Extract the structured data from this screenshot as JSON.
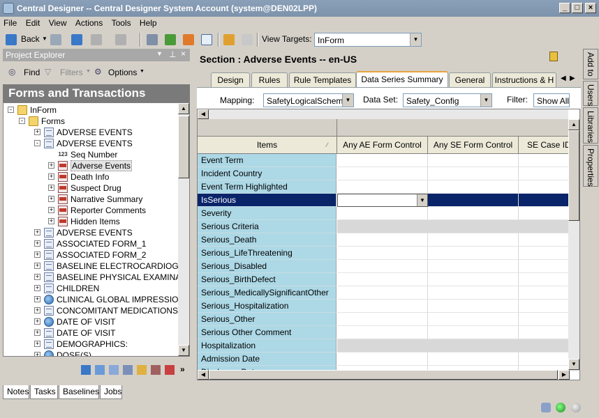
{
  "window": {
    "title": "Central Designer -- Central Designer System Account (system@DEN02LPP)"
  },
  "menu": [
    "File",
    "Edit",
    "View",
    "Actions",
    "Tools",
    "Help"
  ],
  "toolbar": {
    "back_label": "Back",
    "view_targets_label": "View Targets:",
    "view_targets_value": "InForm"
  },
  "project_explorer": {
    "title": "Project Explorer",
    "find_label": "Find",
    "filters_label": "Filters",
    "options_label": "Options",
    "heading": "Forms and Transactions"
  },
  "tree": [
    {
      "label": "InForm",
      "icon": "folder",
      "level": 0,
      "exp": "−"
    },
    {
      "label": "Forms",
      "icon": "folder",
      "level": 1,
      "exp": "−"
    },
    {
      "label": "ADVERSE EVENTS",
      "icon": "form",
      "level": 2,
      "exp": "+"
    },
    {
      "label": "ADVERSE EVENTS",
      "icon": "form",
      "level": 2,
      "exp": "−"
    },
    {
      "label": "Seq Number",
      "icon": "num",
      "level": 3,
      "exp": ""
    },
    {
      "label": "Adverse Events",
      "icon": "section",
      "level": 3,
      "exp": "+",
      "selected": true
    },
    {
      "label": "Death Info",
      "icon": "section",
      "level": 3,
      "exp": "+"
    },
    {
      "label": "Suspect Drug",
      "icon": "section",
      "level": 3,
      "exp": "+"
    },
    {
      "label": "Narrative Summary",
      "icon": "section",
      "level": 3,
      "exp": "+"
    },
    {
      "label": "Reporter Comments",
      "icon": "section",
      "level": 3,
      "exp": "+"
    },
    {
      "label": "Hidden Items",
      "icon": "section",
      "level": 3,
      "exp": "+"
    },
    {
      "label": "ADVERSE EVENTS",
      "icon": "form",
      "level": 2,
      "exp": "+"
    },
    {
      "label": "ASSOCIATED FORM_1",
      "icon": "form",
      "level": 2,
      "exp": "+"
    },
    {
      "label": "ASSOCIATED FORM_2",
      "icon": "form",
      "level": 2,
      "exp": "+"
    },
    {
      "label": "BASELINE ELECTROCARDIOG",
      "icon": "form",
      "level": 2,
      "exp": "+"
    },
    {
      "label": "BASELINE PHYSICAL EXAMINA",
      "icon": "form",
      "level": 2,
      "exp": "+"
    },
    {
      "label": "CHILDREN",
      "icon": "form",
      "level": 2,
      "exp": "+"
    },
    {
      "label": "CLINICAL GLOBAL IMPRESSIO",
      "icon": "globe",
      "level": 2,
      "exp": "+"
    },
    {
      "label": "CONCOMITANT MEDICATIONS",
      "icon": "form",
      "level": 2,
      "exp": "+"
    },
    {
      "label": "DATE OF VISIT",
      "icon": "globe",
      "level": 2,
      "exp": "+"
    },
    {
      "label": "DATE OF VISIT",
      "icon": "form",
      "level": 2,
      "exp": "+"
    },
    {
      "label": "DEMOGRAPHICS:",
      "icon": "form",
      "level": 2,
      "exp": "+"
    },
    {
      "label": "DOSE(S)",
      "icon": "globe",
      "level": 2,
      "exp": "+"
    }
  ],
  "bottom_tabs": [
    "Notes",
    "Tasks",
    "Baselines",
    "Jobs"
  ],
  "section": {
    "title": "Section : Adverse Events -- en-US",
    "tabs": [
      "Design",
      "Rules",
      "Rule Templates",
      "Data Series Summary",
      "General",
      "Instructions & H"
    ],
    "active_tab": 3,
    "mapping_label": "Mapping:",
    "mapping_value": "SafetyLogicalSchema",
    "dataset_label": "Data Set:",
    "dataset_value": "Safety_Config",
    "filter_label": "Filter:",
    "filter_value": "Show All"
  },
  "grid": {
    "columns": [
      "Items",
      "Any AE Form Control",
      "Any SE Form Control",
      "SE Case ID"
    ],
    "rows": [
      {
        "item": "Event Term",
        "style": ""
      },
      {
        "item": "Incident Country",
        "style": ""
      },
      {
        "item": "Event Term Highlighted",
        "style": ""
      },
      {
        "item": "IsSerious",
        "style": "sel"
      },
      {
        "item": "Severity",
        "style": ""
      },
      {
        "item": "Serious Criteria",
        "style": "gray"
      },
      {
        "item": "Serious_Death",
        "style": ""
      },
      {
        "item": "Serious_LifeThreatening",
        "style": ""
      },
      {
        "item": "Serious_Disabled",
        "style": ""
      },
      {
        "item": "Serious_BirthDefect",
        "style": ""
      },
      {
        "item": "Serious_MedicallySignificantOther",
        "style": ""
      },
      {
        "item": "Serious_Hospitalization",
        "style": ""
      },
      {
        "item": "Serious_Other",
        "style": ""
      },
      {
        "item": "Serious Other Comment",
        "style": ""
      },
      {
        "item": "Hospitalization",
        "style": "gray"
      },
      {
        "item": "Admission Date",
        "style": ""
      },
      {
        "item": "Discharge Date",
        "style": ""
      }
    ]
  },
  "right_tabs": [
    "Add to",
    "Users",
    "Libraries",
    "Properties"
  ]
}
